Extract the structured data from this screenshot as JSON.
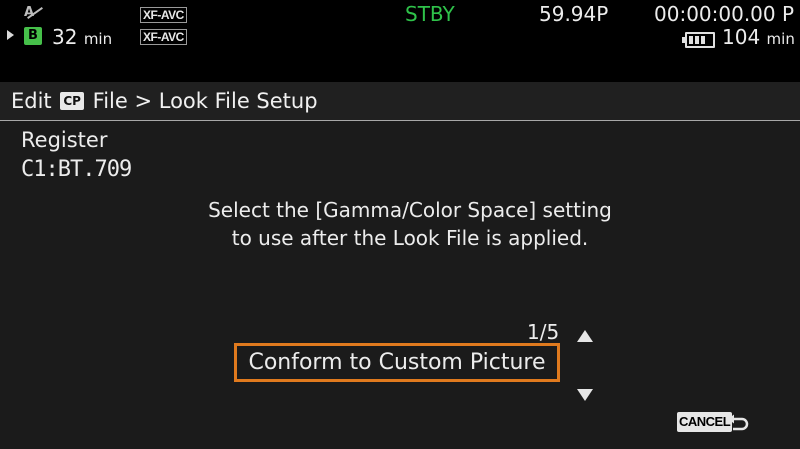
{
  "status_bar": {
    "slot_a_icon": "A",
    "slot_b_label": "B",
    "rec_time_b_value": "32",
    "rec_time_b_unit": "min",
    "codec_1": "XF-AVC",
    "codec_2": "XF-AVC",
    "mode": "STBY",
    "frame_rate": "59.94P",
    "timecode": "00:00:00.00 P",
    "battery_value": "104",
    "battery_unit": "min",
    "battery_level": 0.8
  },
  "header": {
    "edit": "Edit",
    "cp_icon": "CP",
    "path": "File > Look File Setup"
  },
  "content": {
    "register_label": "Register",
    "register_value": "C1:BT.709",
    "instruction_line1": "Select the [Gamma/Color Space] setting",
    "instruction_line2": "to use after the Look File is applied.",
    "page_indicator": "1/5",
    "selected_option": "Conform to Custom Picture"
  },
  "footer": {
    "cancel_label": "CANCEL"
  },
  "colors": {
    "background": "#1b1b1b",
    "status_bar": "#000000",
    "stby": "#2fc24a",
    "slot_b": "#46c04a",
    "selection_border": "#e07a1e"
  }
}
